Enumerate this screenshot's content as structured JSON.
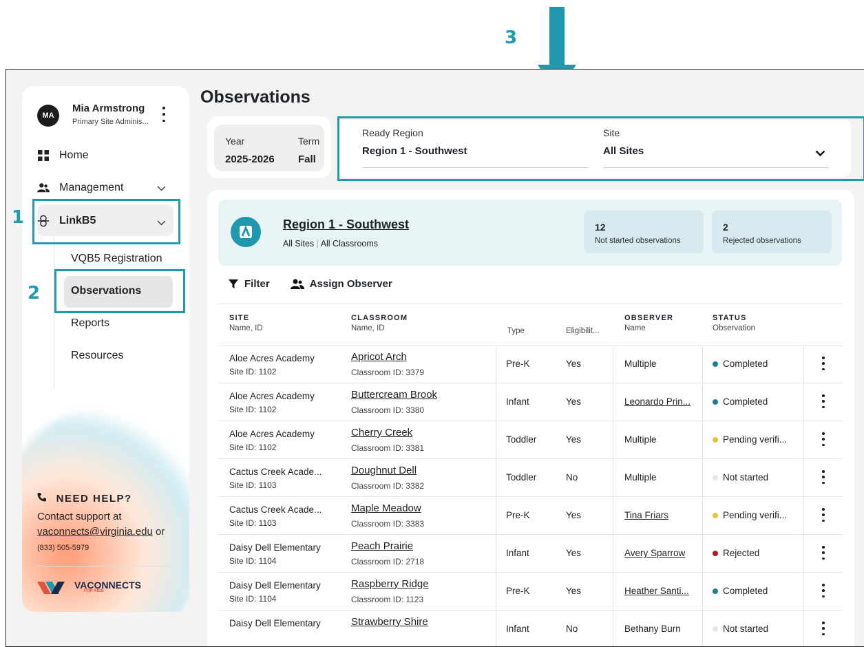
{
  "callouts": {
    "c1": "1",
    "c2": "2",
    "c3": "3"
  },
  "user": {
    "initials": "MA",
    "name": "Mia Armstrong",
    "role": "Primary Site Adminis..."
  },
  "nav": {
    "home": "Home",
    "management": "Management",
    "linkb5": "LinkB5",
    "sub": [
      "VQB5 Registration",
      "Observations",
      "Reports",
      "Resources"
    ]
  },
  "help": {
    "title": "NEED HELP?",
    "text": "Contact support at",
    "email": "vaconnects@virginia.edu",
    "or": "or",
    "phone": "(833) 505-5979"
  },
  "logo": {
    "name": "VACONNECTS",
    "sub": "FOR KIDS"
  },
  "page": {
    "title": "Observations"
  },
  "yearterm": {
    "year_label": "Year",
    "year_value": "2025-2026",
    "term_label": "Term",
    "term_value": "Fall"
  },
  "filters": {
    "region_label": "Ready Region",
    "region_value": "Region 1 - Southwest",
    "site_label": "Site",
    "site_value": "All Sites"
  },
  "banner": {
    "title": "Region 1 - Southwest",
    "sub_sites": "All Sites",
    "sub_classrooms": "All Classrooms",
    "stats": [
      {
        "value": "12",
        "label": "Not started observations"
      },
      {
        "value": "2",
        "label": "Rejected observations"
      }
    ]
  },
  "toolbar": {
    "filter": "Filter",
    "assign": "Assign Observer"
  },
  "table": {
    "headers": {
      "site": "SITE",
      "site_sub": "Name, ID",
      "classroom": "CLASSROOM",
      "classroom_sub": "Name, ID",
      "type": "Type",
      "eligibility": "Eligibilit...",
      "observer": "OBSERVER",
      "observer_sub": "Name",
      "status": "STATUS",
      "status_sub": "Observation"
    },
    "rows": [
      {
        "site": "Aloe Acres Academy",
        "site_id": "Site ID: 1102",
        "classroom": "Apricot Arch",
        "classroom_id": "Classroom ID: 3379",
        "type": "Pre-K",
        "eligible": "Yes",
        "observer": "Multiple",
        "observer_link": false,
        "status": "Completed",
        "status_color": "#1a7f97"
      },
      {
        "site": "Aloe Acres Academy",
        "site_id": "Site ID: 1102",
        "classroom": "Buttercream Brook",
        "classroom_id": "Classroom ID: 3380",
        "type": "Infant",
        "eligible": "Yes",
        "observer": "Leonardo Prin...",
        "observer_link": true,
        "status": "Completed",
        "status_color": "#1a7f97"
      },
      {
        "site": "Aloe Acres Academy",
        "site_id": "Site ID: 1102",
        "classroom": "Cherry Creek",
        "classroom_id": "Classroom ID: 3381",
        "type": "Toddler",
        "eligible": "Yes",
        "observer": "Multiple",
        "observer_link": false,
        "status": "Pending verifi...",
        "status_color": "#e8c23a"
      },
      {
        "site": "Cactus Creek Acade...",
        "site_id": "Site ID: 1103",
        "classroom": "Doughnut Dell",
        "classroom_id": "Classroom ID: 3382",
        "type": "Toddler",
        "eligible": "No",
        "observer": "Multiple",
        "observer_link": false,
        "status": "Not started",
        "status_color": "#dfe7ec"
      },
      {
        "site": "Cactus Creek Acade...",
        "site_id": "Site ID: 1103",
        "classroom": "Maple Meadow",
        "classroom_id": "Classroom ID: 3383",
        "type": "Pre-K",
        "eligible": "Yes",
        "observer": "Tina Friars",
        "observer_link": true,
        "status": "Pending verifi...",
        "status_color": "#e8c23a"
      },
      {
        "site": "Daisy Dell Elementary",
        "site_id": "Site ID: 1104",
        "classroom": "Peach Prairie",
        "classroom_id": "Classroom ID: 2718",
        "type": "Infant",
        "eligible": "Yes",
        "observer": "Avery Sparrow",
        "observer_link": true,
        "status": "Rejected",
        "status_color": "#c0141c"
      },
      {
        "site": "Daisy Dell Elementary",
        "site_id": "Site ID: 1104",
        "classroom": "Raspberry Ridge",
        "classroom_id": "Classroom ID: 1123",
        "type": "Pre-K",
        "eligible": "Yes",
        "observer": "Heather Santi...",
        "observer_link": true,
        "status": "Completed",
        "status_color": "#1a7f97"
      },
      {
        "site": "Daisy Dell Elementary",
        "site_id": "",
        "classroom": "Strawberry Shire",
        "classroom_id": "",
        "type": "Infant",
        "eligible": "No",
        "observer": "Bethany Burn",
        "observer_link": false,
        "status": "Not started",
        "status_color": "#dfe7ec"
      }
    ]
  }
}
